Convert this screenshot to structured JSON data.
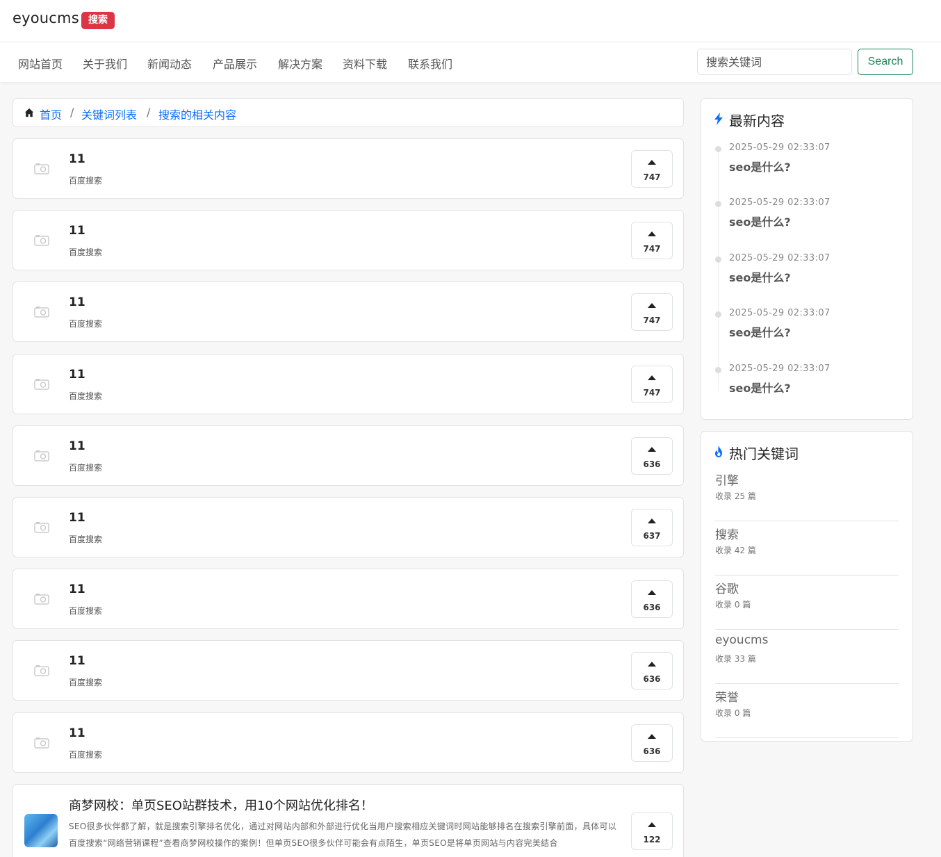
{
  "header": {
    "logo": "eyoucms",
    "badge": "搜索"
  },
  "nav": {
    "items": [
      "网站首页",
      "关于我们",
      "新闻动态",
      "产品展示",
      "解决方案",
      "资料下载",
      "联系我们"
    ],
    "search_placeholder": "搜索关键词",
    "search_button": "Search"
  },
  "breadcrumb": {
    "icon": "home-icon",
    "items": [
      "首页",
      "关键词列表",
      "搜索的相关内容"
    ],
    "separator": "/"
  },
  "list": [
    {
      "title": "11",
      "sub": "百度搜索",
      "votes": "747"
    },
    {
      "title": "11",
      "sub": "百度搜索",
      "votes": "747"
    },
    {
      "title": "11",
      "sub": "百度搜索",
      "votes": "747"
    },
    {
      "title": "11",
      "sub": "百度搜索",
      "votes": "747"
    },
    {
      "title": "11",
      "sub": "百度搜索",
      "votes": "636"
    },
    {
      "title": "11",
      "sub": "百度搜索",
      "votes": "637"
    },
    {
      "title": "11",
      "sub": "百度搜索",
      "votes": "636"
    },
    {
      "title": "11",
      "sub": "百度搜索",
      "votes": "636"
    },
    {
      "title": "11",
      "sub": "百度搜索",
      "votes": "636"
    }
  ],
  "featured": {
    "title": "商梦网校：单页SEO站群技术，用10个网站优化排名！",
    "desc": "SEO很多伙伴都了解，就是搜索引擎排名优化，通过对网站内部和外部进行优化当用户搜索相应关键词时网站能够排名在搜索引擎前面，具体可以百度搜索“网络营销课程”查看商梦网校操作的案例！但单页SEO很多伙伴可能会有点陌生，单页SEO是将单页网站与内容完美结合",
    "votes": "122"
  },
  "latest": {
    "title": "最新内容",
    "icon": "lightning-icon",
    "items": [
      {
        "date": "2025-05-29 02:33:07",
        "title": "seo是什么?"
      },
      {
        "date": "2025-05-29 02:33:07",
        "title": "seo是什么?"
      },
      {
        "date": "2025-05-29 02:33:07",
        "title": "seo是什么?"
      },
      {
        "date": "2025-05-29 02:33:07",
        "title": "seo是什么?"
      },
      {
        "date": "2025-05-29 02:33:07",
        "title": "seo是什么?"
      }
    ]
  },
  "hot": {
    "title": "热门关键词",
    "icon": "fire-icon",
    "items": [
      {
        "name": "引擎",
        "count": "收录 25 篇"
      },
      {
        "name": "搜索",
        "count": "收录 42 篇"
      },
      {
        "name": "谷歌",
        "count": "收录 0 篇"
      },
      {
        "name": "eyoucms",
        "count": "收录 33 篇"
      },
      {
        "name": "荣誉",
        "count": "收录 0 篇"
      }
    ]
  },
  "colors": {
    "accent_blue": "#0d6efd",
    "badge_red": "#dc3545",
    "search_green": "#198754"
  }
}
